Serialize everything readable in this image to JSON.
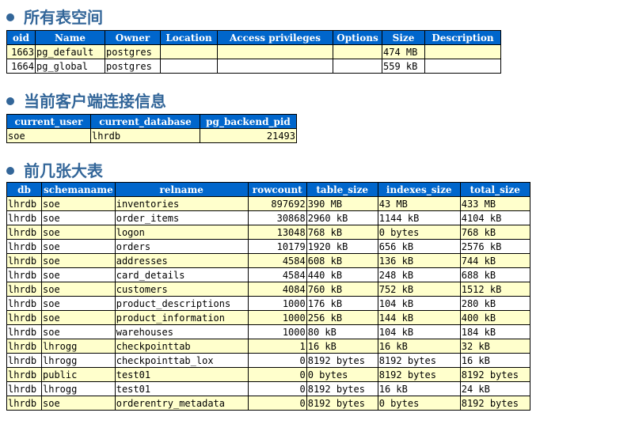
{
  "sections": [
    {
      "title": "所有表空间",
      "columns": [
        "oid",
        "Name",
        "Owner",
        "Location",
        "Access privileges",
        "Options",
        "Size",
        "Description"
      ],
      "numeric_cols": [
        0
      ],
      "col_widths": [
        36,
        88,
        70,
        72,
        146,
        62,
        54,
        96
      ],
      "rows": [
        [
          "1663",
          "pg_default",
          "postgres",
          "",
          "",
          "",
          "474 MB",
          ""
        ],
        [
          "1664",
          "pg_global",
          "postgres",
          "",
          "",
          "",
          "559 kB",
          ""
        ]
      ]
    },
    {
      "title": "当前客户端连接信息",
      "columns": [
        "current_user",
        "current_database",
        "pg_backend_pid"
      ],
      "numeric_cols": [
        2
      ],
      "col_widths": [
        106,
        138,
        122
      ],
      "rows": [
        [
          "soe",
          "lhrdb",
          "21493"
        ]
      ]
    },
    {
      "title": "前几张大表",
      "columns": [
        "db",
        "schemaname",
        "relname",
        "rowcount",
        "table_size",
        "indexes_size",
        "total_size"
      ],
      "numeric_cols": [
        3
      ],
      "col_widths": [
        44,
        89,
        168,
        74,
        90,
        104,
        88
      ],
      "rows": [
        [
          "lhrdb",
          "soe",
          "inventories",
          "897692",
          "390 MB",
          "43 MB",
          "433 MB"
        ],
        [
          "lhrdb",
          "soe",
          "order_items",
          "30868",
          "2960 kB",
          "1144 kB",
          "4104 kB"
        ],
        [
          "lhrdb",
          "soe",
          "logon",
          "13048",
          "768 kB",
          "0 bytes",
          "768 kB"
        ],
        [
          "lhrdb",
          "soe",
          "orders",
          "10179",
          "1920 kB",
          "656 kB",
          "2576 kB"
        ],
        [
          "lhrdb",
          "soe",
          "addresses",
          "4584",
          "608 kB",
          "136 kB",
          "744 kB"
        ],
        [
          "lhrdb",
          "soe",
          "card_details",
          "4584",
          "440 kB",
          "248 kB",
          "688 kB"
        ],
        [
          "lhrdb",
          "soe",
          "customers",
          "4084",
          "760 kB",
          "752 kB",
          "1512 kB"
        ],
        [
          "lhrdb",
          "soe",
          "product_descriptions",
          "1000",
          "176 kB",
          "104 kB",
          "280 kB"
        ],
        [
          "lhrdb",
          "soe",
          "product_information",
          "1000",
          "256 kB",
          "144 kB",
          "400 kB"
        ],
        [
          "lhrdb",
          "soe",
          "warehouses",
          "1000",
          "80 kB",
          "104 kB",
          "184 kB"
        ],
        [
          "lhrdb",
          "lhrogg",
          "checkpointtab",
          "1",
          "16 kB",
          "16 kB",
          "32 kB"
        ],
        [
          "lhrdb",
          "lhrogg",
          "checkpointtab_lox",
          "0",
          "8192 bytes",
          "8192 bytes",
          "16 kB"
        ],
        [
          "lhrdb",
          "public",
          "test01",
          "0",
          "0 bytes",
          "8192 bytes",
          "8192 bytes"
        ],
        [
          "lhrdb",
          "lhrogg",
          "test01",
          "0",
          "8192 bytes",
          "16 kB",
          "24 kB"
        ],
        [
          "lhrdb",
          "soe",
          "orderentry_metadata",
          "0",
          "8192 bytes",
          "0 bytes",
          "8192 bytes"
        ]
      ]
    }
  ]
}
